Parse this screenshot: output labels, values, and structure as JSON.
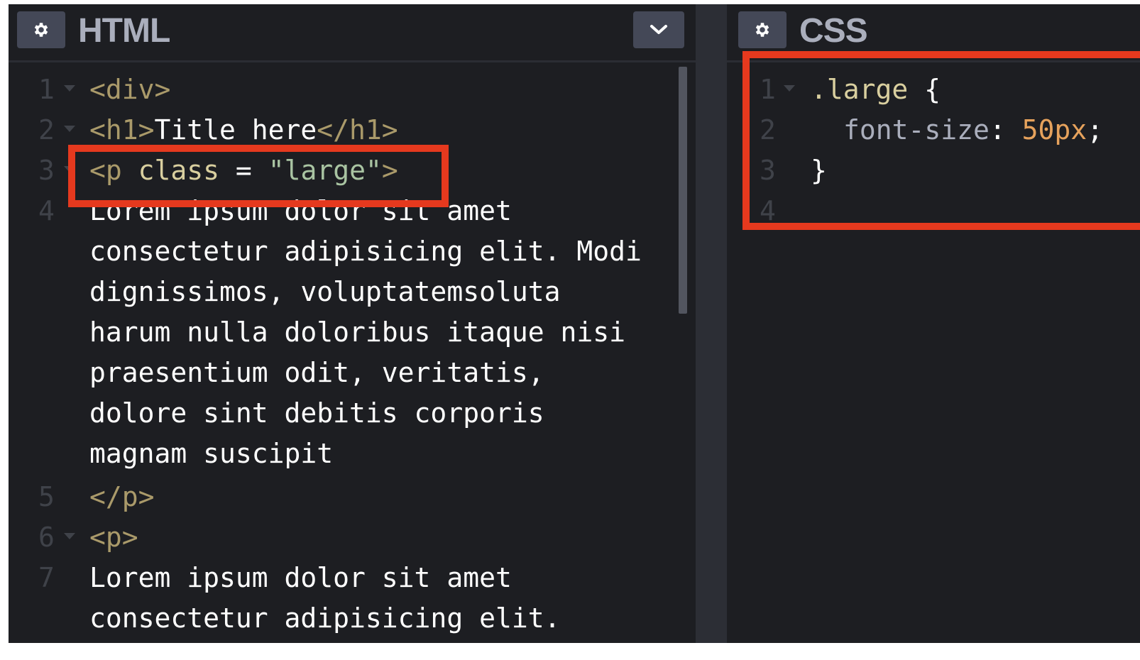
{
  "html_pane": {
    "title": "HTML",
    "settings_icon": "gear-icon",
    "collapse_icon": "chevron-down-icon",
    "line_numbers": [
      "1",
      "2",
      "3",
      "4",
      "5",
      "6",
      "7"
    ],
    "code": {
      "l1_tag": "<div>",
      "l2_open": "<h1>",
      "l2_text": "Title here",
      "l2_close": "</h1>",
      "l3_tag_open": "<p",
      "l3_attr": " class",
      "l3_eq": " = ",
      "l3_str": "\"large\"",
      "l3_tag_close": ">",
      "l4_wrapped": [
        "Lorem ipsum dolor sit amet",
        "consectetur adipisicing elit. Modi",
        "dignissimos, voluptatemsoluta",
        "harum nulla doloribus itaque nisi",
        "praesentium odit, veritatis,",
        "dolore sint debitis corporis",
        "magnam suscipit"
      ],
      "l5_tag": "</p>",
      "l6_tag": "<p>",
      "l7_wrapped": [
        "Lorem ipsum dolor sit amet",
        "consectetur adipisicing elit."
      ]
    }
  },
  "css_pane": {
    "title": "CSS",
    "settings_icon": "gear-icon",
    "line_numbers": [
      "1",
      "2",
      "3",
      "4"
    ],
    "code": {
      "l1_selector": ".large",
      "l1_brace": " {",
      "l2_prop": "font-size",
      "l2_colon": ": ",
      "l2_value": "50px",
      "l2_semi": ";",
      "l3_brace": "}"
    }
  },
  "colors": {
    "editor_bg": "#1d1e22",
    "highlight": "#e5391e",
    "tag": "#aa9a6a",
    "attr": "#d9cf9f",
    "string": "#a9c4a2",
    "number": "#e6a25c"
  }
}
